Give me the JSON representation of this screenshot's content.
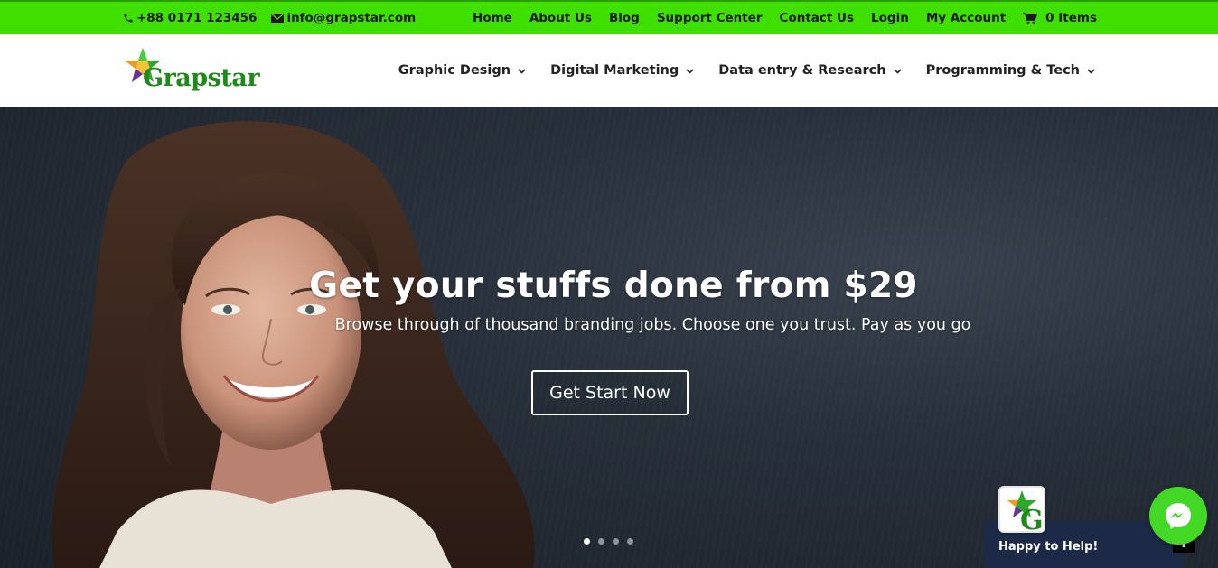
{
  "topbar": {
    "phone": "+88 0171 123456",
    "email": "info@grapstar.com",
    "links": [
      "Home",
      "About Us",
      "Blog",
      "Support Center",
      "Contact Us",
      "Login",
      "My Account"
    ],
    "cart_label": "0 Items"
  },
  "header": {
    "logo_text": "Grapstar",
    "nav": [
      {
        "label": "Graphic Design"
      },
      {
        "label": "Digital Marketing"
      },
      {
        "label": "Data entry & Research"
      },
      {
        "label": "Programming & Tech"
      }
    ]
  },
  "hero": {
    "title": "Get your stuffs done from $29",
    "subtitle": "Browse through of thousand branding jobs. Choose one you trust. Pay as you go",
    "cta_label": "Get Start Now",
    "slides": 4,
    "active_slide": 1
  },
  "chat": {
    "label": "Happy to Help!",
    "toggle": "+"
  },
  "colors": {
    "topbar": "#3fe000",
    "brand_green": "#1d8a1a",
    "chat_panel": "#1c2a47",
    "messenger": "#44d826"
  }
}
